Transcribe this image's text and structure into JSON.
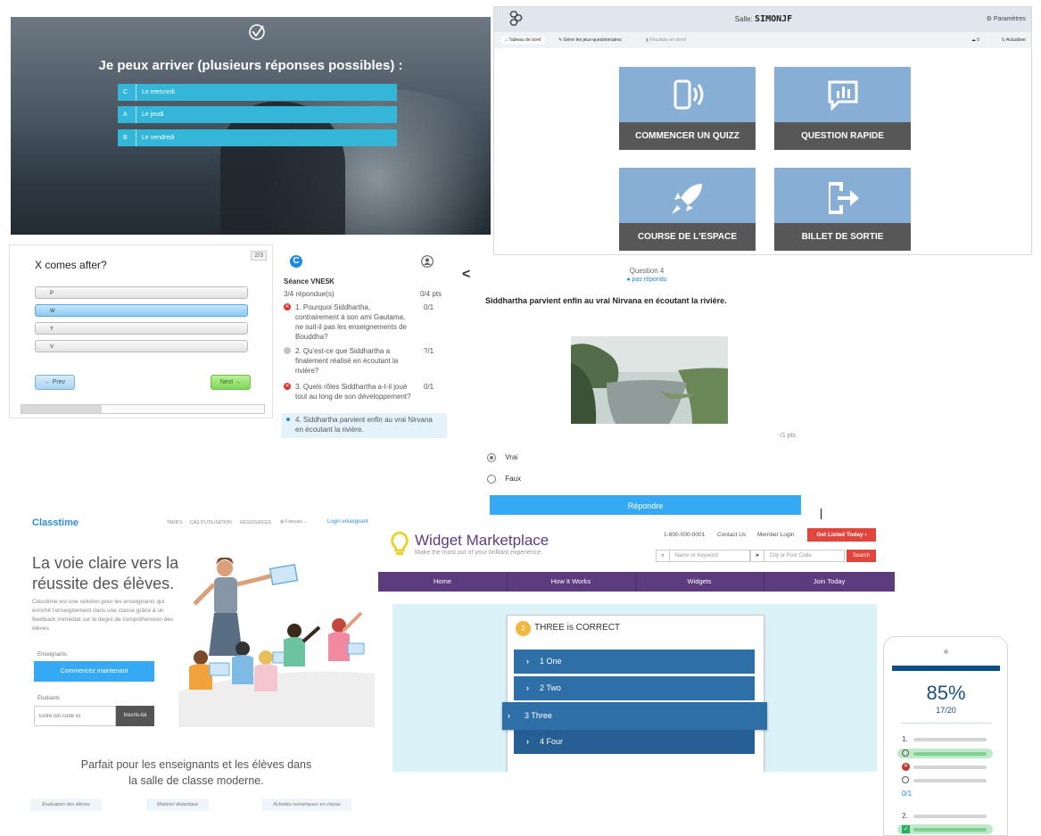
{
  "quiz_photo": {
    "question": "Je peux arriver (plusieurs réponses possibles) :",
    "options": [
      {
        "letter": "C",
        "text": "Le mercredi"
      },
      {
        "letter": "A",
        "text": "Le jeudi"
      },
      {
        "letter": "B",
        "text": "Le vendredi"
      }
    ]
  },
  "dashboard": {
    "room_label": "Salle:",
    "room_name": "SIMONJF",
    "settings": "Paramètres",
    "nav": [
      "Tableau de bord",
      "Gérer les jeux-questionnaires",
      "Résultats en direct"
    ],
    "count": "0",
    "refresh": "Actualiser",
    "tiles": [
      "COMMENCER UN QUIZZ",
      "QUESTION RAPIDE",
      "COURSE DE L'ESPACE",
      "BILLET DE SORTIE"
    ]
  },
  "x_quiz": {
    "badge": "2/3",
    "question": "X comes after?",
    "options": [
      "P",
      "W",
      "Y",
      "V"
    ],
    "selected_index": 1,
    "prev": "Prev",
    "next": "Next",
    "progress": 0.33
  },
  "session": {
    "title": "Séance VNE5K",
    "answered": "3/4 répondue(s)",
    "points": "0/4 pts",
    "questions": [
      {
        "text": "1. Pourquoi Siddhartha, contrairement à son ami Gautama, ne suit-il pas les enseignements de Bouddha?",
        "score": "0/1",
        "status": "wrong"
      },
      {
        "text": "2. Qu'est-ce que Siddhartha a finalement réalisé en écoutant la rivière?",
        "score": "?/1",
        "status": "pending"
      },
      {
        "text": "3. Quels rôles Siddhartha a-t-il joué tout au long de son développement?",
        "score": "0/1",
        "status": "wrong"
      },
      {
        "text": "4. Siddhartha parvient enfin au vrai Nirvana en écoutant la rivière.",
        "score": "",
        "status": "current"
      }
    ]
  },
  "question_view": {
    "back": "<",
    "number": "Question 4",
    "status": "pas répondu",
    "statement": "Siddhartha parvient enfin au vrai Nirvana en écoutant la rivière.",
    "points": "-/1 pts",
    "options": [
      "Vrai",
      "Faux"
    ],
    "selected_index": 0,
    "submit": "Répondre"
  },
  "classtime": {
    "logo": "Classtime",
    "nav": [
      "TARIFS",
      "CAS D'UTILISATION",
      "RESSOURCES",
      "Français",
      "Login enseignant"
    ],
    "headline": "La voie claire vers la réussite des élèves.",
    "intro": "Classtime est une solution pour les enseignants qui enrichit l'enseignement dans une classe grâce à un feedback immédiat sur le degré de compréhension des élèves.",
    "teachers_label": "Enseignants",
    "teachers_cta": "Commencez maintenant",
    "students_label": "Étudiants",
    "code_placeholder": "Entre ton code ici",
    "join": "Inscris-toi",
    "tagline": "Parfait pour les enseignants et les élèves dans la salle de classe moderne.",
    "features": [
      "Évaluation des élèves",
      "Matériel didactique",
      "Activités numériques en classe"
    ]
  },
  "widget": {
    "title": "Widget Marketplace",
    "subtitle": "Make the most out of your brilliant experience.",
    "phone": "1-800-000-0001",
    "contact": "Contact Us",
    "login": "Member Login",
    "cta": "Get Listed Today",
    "keyword_placeholder": "Name or Keyword",
    "city_placeholder": "City or Post Code",
    "search": "Search",
    "menu": [
      "Home",
      "How It Works",
      "Widgets",
      "Join Today"
    ],
    "quiz_number": "2",
    "quiz_title": "THREE is CORRECT",
    "options": [
      "1 One",
      "2 Two",
      "3 Three",
      "4 Four"
    ],
    "highlight_index": 2
  },
  "phone_result": {
    "percent": "85%",
    "score": "17/20",
    "q1": "1.",
    "q1_score": "0/1",
    "q2": "2."
  },
  "colors": {
    "quiz_blue": "#33b6d8",
    "tile_blue": "#87aed5",
    "tile_caption": "#575757",
    "widget_purple": "#5c3c7e",
    "widget_red": "#e2453c",
    "option_blue": "#2f6fa8"
  }
}
